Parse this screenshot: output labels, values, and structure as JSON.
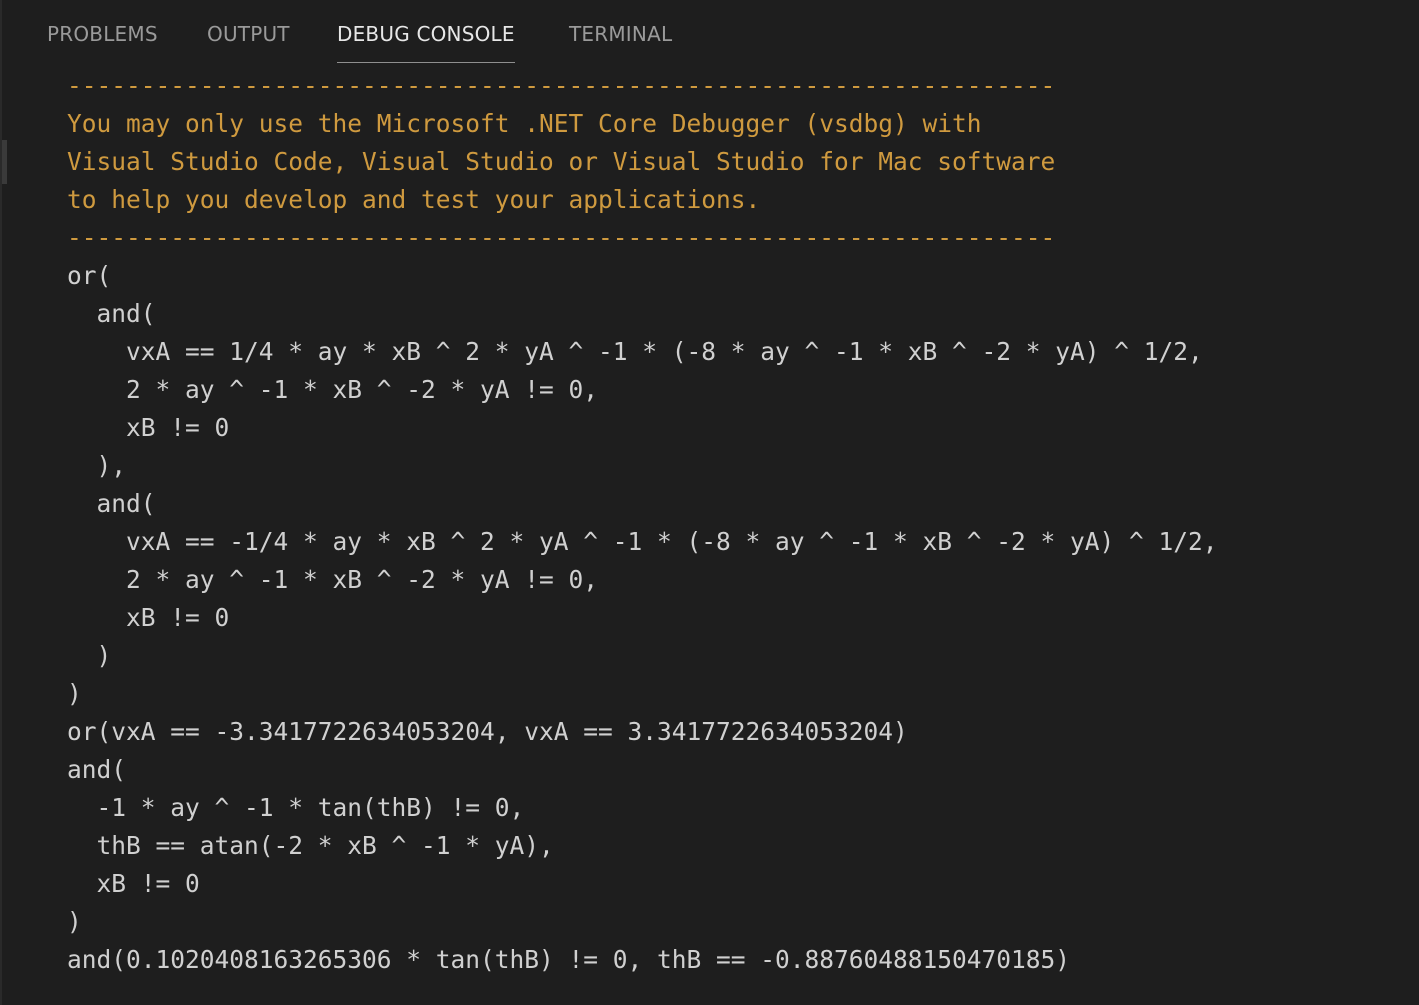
{
  "tabs": [
    {
      "label": "PROBLEMS",
      "active": false
    },
    {
      "label": "OUTPUT",
      "active": false
    },
    {
      "label": "DEBUG CONSOLE",
      "active": true
    },
    {
      "label": "TERMINAL",
      "active": false
    }
  ],
  "colors": {
    "background": "#1e1e1e",
    "warning_text": "#cf9a3f",
    "output_text": "#d0d0d0",
    "active_tab": "#e7e7e7",
    "inactive_tab": "#9a9a9a"
  },
  "console": {
    "lines": [
      "-------------------------------------------------------------------",
      "You may only use the Microsoft .NET Core Debugger (vsdbg) with",
      "Visual Studio Code, Visual Studio or Visual Studio for Mac software",
      "to help you develop and test your applications.",
      "-------------------------------------------------------------------",
      "or(",
      "  and(",
      "    vxA == 1/4 * ay * xB ^ 2 * yA ^ -1 * (-8 * ay ^ -1 * xB ^ -2 * yA) ^ 1/2,",
      "    2 * ay ^ -1 * xB ^ -2 * yA != 0,",
      "    xB != 0",
      "  ),",
      "  and(",
      "    vxA == -1/4 * ay * xB ^ 2 * yA ^ -1 * (-8 * ay ^ -1 * xB ^ -2 * yA) ^ 1/2,",
      "    2 * ay ^ -1 * xB ^ -2 * yA != 0,",
      "    xB != 0",
      "  )",
      ")",
      "or(vxA == -3.3417722634053204, vxA == 3.3417722634053204)",
      "and(",
      "  -1 * ay ^ -1 * tan(thB) != 0,",
      "  thB == atan(-2 * xB ^ -1 * yA),",
      "  xB != 0",
      ")",
      "and(0.1020408163265306 * tan(thB) != 0, thB == -0.88760488150470185)"
    ]
  }
}
